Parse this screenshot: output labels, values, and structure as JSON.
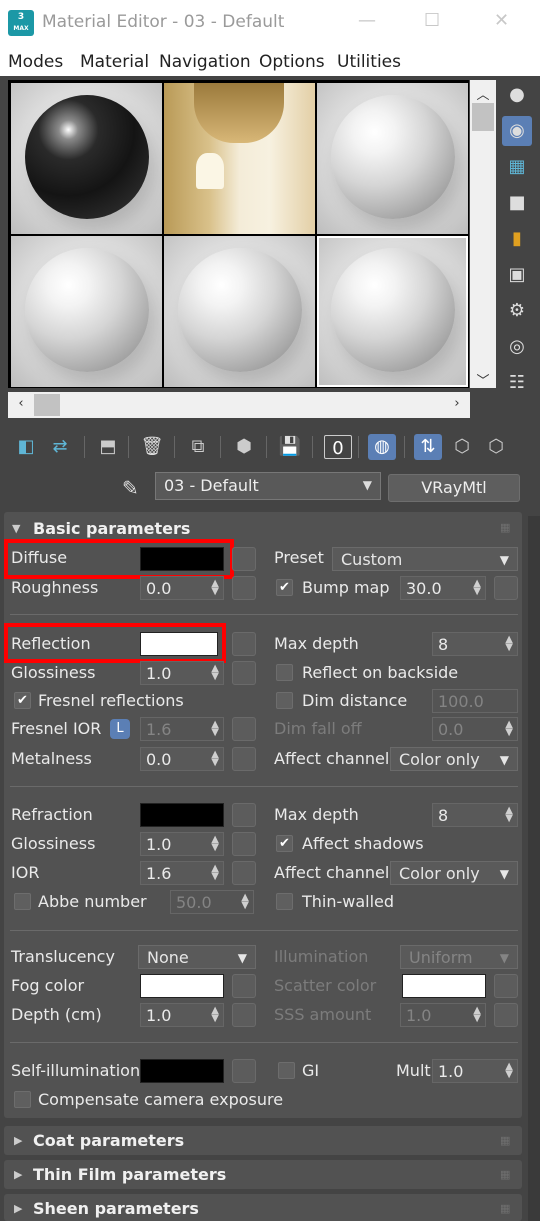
{
  "window": {
    "title": "Material Editor - 03 - Default",
    "logo_text": "3",
    "logo_sub": "MAX"
  },
  "menu": [
    "Modes",
    "Material",
    "Navigation",
    "Options",
    "Utilities"
  ],
  "material": {
    "name": "03 - Default",
    "type": "VRayMtl"
  },
  "basic": {
    "header": "Basic parameters",
    "diffuse_label": "Diffuse",
    "diffuse_color": "#000000",
    "preset_label": "Preset",
    "preset_value": "Custom",
    "roughness_label": "Roughness",
    "roughness_value": "0.0",
    "bump_label": "Bump map",
    "bump_value": "30.0",
    "reflection_label": "Reflection",
    "reflection_color": "#ffffff",
    "max_depth_label": "Max depth",
    "max_depth_value": "8",
    "glossiness_label": "Glossiness",
    "glossiness_value": "1.0",
    "reflect_backside_label": "Reflect on backside",
    "fresnel_label": "Fresnel reflections",
    "dim_distance_label": "Dim distance",
    "dim_distance_value": "100.0",
    "fresnel_ior_label": "Fresnel IOR",
    "fresnel_ior_lock": "L",
    "fresnel_ior_value": "1.6",
    "dim_falloff_label": "Dim fall off",
    "dim_falloff_value": "0.0",
    "metalness_label": "Metalness",
    "metalness_value": "0.0",
    "affect_channels_label": "Affect channels",
    "affect_channels_value": "Color only",
    "refraction_label": "Refraction",
    "refraction_color": "#000000",
    "refr_max_depth_label": "Max depth",
    "refr_max_depth_value": "8",
    "refr_glossiness_label": "Glossiness",
    "refr_glossiness_value": "1.0",
    "affect_shadows_label": "Affect shadows",
    "ior_label": "IOR",
    "ior_value": "1.6",
    "refr_affect_channels_label": "Affect channels",
    "refr_affect_channels_value": "Color only",
    "abbe_label": "Abbe number",
    "abbe_value": "50.0",
    "thin_walled_label": "Thin-walled",
    "translucency_label": "Translucency",
    "translucency_value": "None",
    "illumination_label": "Illumination",
    "illumination_value": "Uniform",
    "fog_color_label": "Fog color",
    "fog_color": "#ffffff",
    "scatter_color_label": "Scatter color",
    "scatter_color": "#ffffff",
    "depth_label": "Depth (cm)",
    "depth_value": "1.0",
    "sss_label": "SSS amount",
    "sss_value": "1.0",
    "self_illum_label": "Self-illumination",
    "self_illum_color": "#000000",
    "gi_label": "GI",
    "mult_label": "Mult",
    "mult_value": "1.0",
    "comp_camera_label": "Compensate camera exposure"
  },
  "rollouts": [
    "Coat parameters",
    "Thin Film parameters",
    "Sheen parameters"
  ],
  "checks": {
    "bump_map": true,
    "reflect_backside": false,
    "fresnel": true,
    "dim_distance": false,
    "affect_shadows": true,
    "abbe": false,
    "thin_walled": false,
    "gi": false,
    "comp_camera": false
  },
  "highlight_color": "#ff0000",
  "accent": "#5b7fb5"
}
